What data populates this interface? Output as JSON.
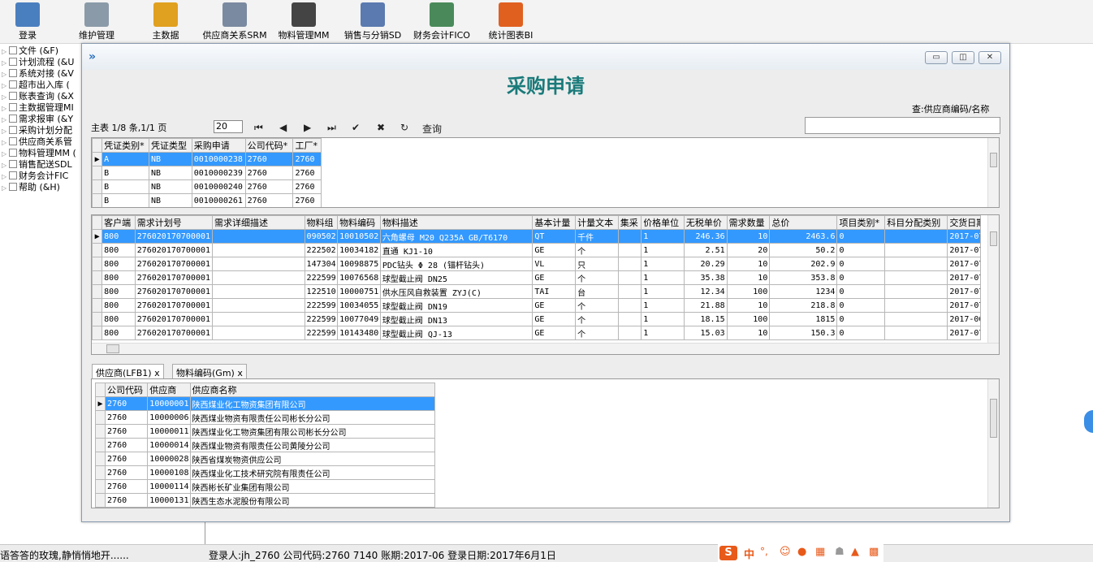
{
  "toolbar": [
    {
      "label": "登录",
      "icon": "login-icon",
      "color": "#4a7fbf"
    },
    {
      "label": "维护管理",
      "icon": "maintenance-icon",
      "color": "#8a9aa8"
    },
    {
      "label": "主数据",
      "icon": "master-data-icon",
      "color": "#e0a020"
    },
    {
      "label": "供应商关系SRM",
      "icon": "supplier-icon",
      "color": "#7a8aa0"
    },
    {
      "label": "物料管理MM",
      "icon": "barcode-icon",
      "color": "#444444"
    },
    {
      "label": "销售与分销SD",
      "icon": "sales-icon",
      "color": "#5a7ab0"
    },
    {
      "label": "财务会计FICO",
      "icon": "finance-icon",
      "color": "#4a8a5a"
    },
    {
      "label": "统计图表BI",
      "icon": "chart-icon",
      "color": "#e06020"
    }
  ],
  "tree": [
    "文件 (&F)",
    "计划流程 (&U",
    "系统对接 (&V",
    "超市出入库 (",
    "账表查询 (&X",
    "主数据管理MI",
    "需求报审 (&Y",
    "采购计划分配",
    "供应商关系管",
    "物料管理MM (",
    "销售配送SDL",
    "财务会计FIC",
    "帮助 (&H)"
  ],
  "window": {
    "title": "采购申请",
    "query_label": "查:供应商编码/名称",
    "query_value": "",
    "record_info": "主表 1/8 条,1/1 页",
    "page_size": "20",
    "query_button": "查询",
    "buttons": [
      "minimize",
      "maximize",
      "close"
    ]
  },
  "master": {
    "columns": [
      "凭证类别*",
      "凭证类型",
      "采购申请",
      "公司代码*",
      "工厂*"
    ],
    "rows": [
      [
        "A",
        "NB",
        "0010000238",
        "2760",
        "2760"
      ],
      [
        "B",
        "NB",
        "0010000239",
        "2760",
        "2760"
      ],
      [
        "B",
        "NB",
        "0010000240",
        "2760",
        "2760"
      ],
      [
        "B",
        "NB",
        "0010000261",
        "2760",
        "2760"
      ]
    ]
  },
  "detail": {
    "columns": [
      "客户端",
      "需求计划号",
      "需求详细描述",
      "物料组",
      "物料编码",
      "物料描述",
      "基本计量",
      "计量文本",
      "集采",
      "价格单位",
      "无税单价",
      "需求数量",
      "总价",
      "项目类别*",
      "科目分配类别",
      "交货日期"
    ],
    "rows": [
      [
        "800",
        "276020170700001",
        "",
        "090502",
        "10010502",
        "六角螺母 M20 Q235A GB/T6170",
        "QT",
        "千件",
        "",
        "1",
        "246.36",
        "10",
        "2463.6",
        "0",
        "",
        "2017-07"
      ],
      [
        "800",
        "276020170700001",
        "",
        "222502",
        "10034182",
        "直通 KJ1-10",
        "GE",
        "个",
        "",
        "1",
        "2.51",
        "20",
        "50.2",
        "0",
        "",
        "2017-07"
      ],
      [
        "800",
        "276020170700001",
        "",
        "147304",
        "10098875",
        "PDC钻头 Φ 28 (锚杆钻头)",
        "VL",
        "只",
        "",
        "1",
        "20.29",
        "10",
        "202.9",
        "0",
        "",
        "2017-07"
      ],
      [
        "800",
        "276020170700001",
        "",
        "222599",
        "10076568",
        "球型截止阀 DN25",
        "GE",
        "个",
        "",
        "1",
        "35.38",
        "10",
        "353.8",
        "0",
        "",
        "2017-07"
      ],
      [
        "800",
        "276020170700001",
        "",
        "122510",
        "10000751",
        "供水压风自救装置 ZYJ(C)",
        "TAI",
        "台",
        "",
        "1",
        "12.34",
        "100",
        "1234",
        "0",
        "",
        "2017-07"
      ],
      [
        "800",
        "276020170700001",
        "",
        "222599",
        "10034055",
        "球型截止阀 DN19",
        "GE",
        "个",
        "",
        "1",
        "21.88",
        "10",
        "218.8",
        "0",
        "",
        "2017-07"
      ],
      [
        "800",
        "276020170700001",
        "",
        "222599",
        "10077049",
        "球型截止阀 DN13",
        "GE",
        "个",
        "",
        "1",
        "18.15",
        "100",
        "1815",
        "0",
        "",
        "2017-06"
      ],
      [
        "800",
        "276020170700001",
        "",
        "222599",
        "10143480",
        "球型截止阀 QJ-13",
        "GE",
        "个",
        "",
        "1",
        "15.03",
        "10",
        "150.3",
        "0",
        "",
        "2017-07"
      ]
    ]
  },
  "tabs": [
    "供应商(LFB1) x",
    "物料编码(Gm) x"
  ],
  "vendor": {
    "columns": [
      "公司代码",
      "供应商",
      "供应商名称"
    ],
    "rows": [
      [
        "2760",
        "10000001",
        "陕西煤业化工物资集团有限公司"
      ],
      [
        "2760",
        "10000006",
        "陕西煤业物资有限责任公司彬长分公司"
      ],
      [
        "2760",
        "10000011",
        "陕西煤业化工物资集团有限公司彬长分公司"
      ],
      [
        "2760",
        "10000014",
        "陕西煤业物资有限责任公司黄陵分公司"
      ],
      [
        "2760",
        "10000028",
        "陕西省煤炭物资供应公司"
      ],
      [
        "2760",
        "10000108",
        "陕西煤业化工技术研究院有限责任公司"
      ],
      [
        "2760",
        "10000114",
        "陕西彬长矿业集团有限公司"
      ],
      [
        "2760",
        "10000131",
        "陕西生态水泥股份有限公司"
      ]
    ]
  },
  "status": {
    "left": "语答答的玫瑰,静悄悄地开......",
    "main": "登录人:jh_2760 公司代码:2760 7140 账期:2017-06 登录日期:2017年6月1日",
    "ime_label": "中"
  },
  "colors": {
    "accent": "#3399ff",
    "title": "#1a7a7a"
  }
}
